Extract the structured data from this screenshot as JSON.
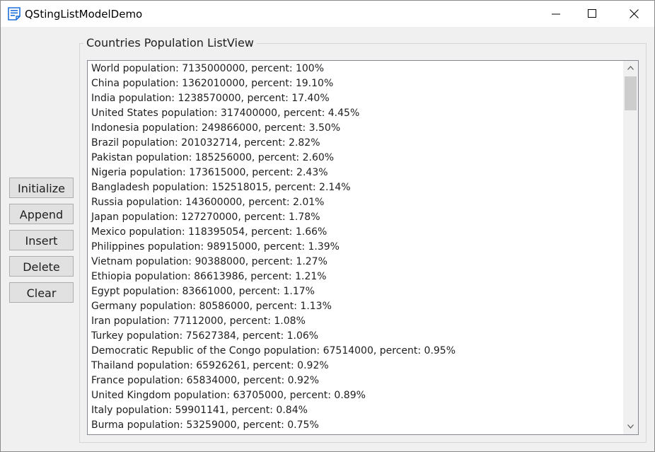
{
  "window": {
    "title": "QStingListModelDemo"
  },
  "buttons": {
    "initialize": "Initialize",
    "append": "Append",
    "insert": "Insert",
    "delete": "Delete",
    "clear": "Clear"
  },
  "group": {
    "title": "Countries Population ListView"
  },
  "list": {
    "items": [
      "World population: 7135000000, percent: 100%",
      "China population: 1362010000, percent: 19.10%",
      "India population: 1238570000, percent: 17.40%",
      "United States population: 317400000, percent: 4.45%",
      "Indonesia population: 249866000, percent: 3.50%",
      "Brazil population: 201032714, percent: 2.82%",
      "Pakistan population: 185256000, percent: 2.60%",
      "Nigeria population: 173615000, percent: 2.43%",
      "Bangladesh population: 152518015, percent: 2.14%",
      "Russia population: 143600000, percent: 2.01%",
      "Japan population: 127270000, percent: 1.78%",
      "Mexico population: 118395054, percent: 1.66%",
      "Philippines population: 98915000, percent: 1.39%",
      "Vietnam population: 90388000, percent: 1.27%",
      "Ethiopia population: 86613986, percent: 1.21%",
      "Egypt population: 83661000, percent: 1.17%",
      "Germany population: 80586000, percent: 1.13%",
      "Iran population: 77112000, percent: 1.08%",
      "Turkey population: 75627384, percent: 1.06%",
      "Democratic Republic of the Congo population: 67514000, percent: 0.95%",
      "Thailand population: 65926261, percent: 0.92%",
      "France population: 65834000, percent: 0.92%",
      "United Kingdom population: 63705000, percent: 0.89%",
      "Italy population: 59901141, percent: 0.84%",
      "Burma population: 53259000, percent: 0.75%"
    ]
  },
  "icons": {
    "app": "list-document-icon",
    "minimize": "minimize-icon",
    "maximize": "maximize-icon",
    "close": "close-icon",
    "scroll_up": "chevron-up-icon",
    "scroll_down": "chevron-down-icon"
  },
  "colors": {
    "app_icon": "#1e6fd9",
    "button_face": "#e1e1e1",
    "scroll_thumb": "#cdcdcd"
  }
}
